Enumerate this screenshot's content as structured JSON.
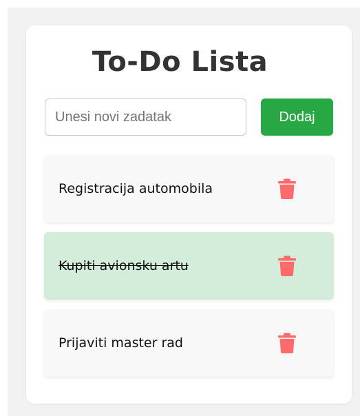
{
  "app": {
    "title": "To-Do Lista"
  },
  "new_task": {
    "placeholder": "Unesi novi zadatak",
    "value": "",
    "add_label": "Dodaj"
  },
  "tasks": [
    {
      "label": "Registracija automobila",
      "completed": false
    },
    {
      "label": "Kupiti avionsku artu",
      "completed": true
    },
    {
      "label": "Prijaviti master rad",
      "completed": false
    }
  ],
  "colors": {
    "add_button": "#28a745",
    "completed_task_bg": "#d4edda",
    "task_bg": "#f8f8f8",
    "delete_icon": "#ff6b6b"
  },
  "icons": {
    "delete": "trash-icon"
  }
}
